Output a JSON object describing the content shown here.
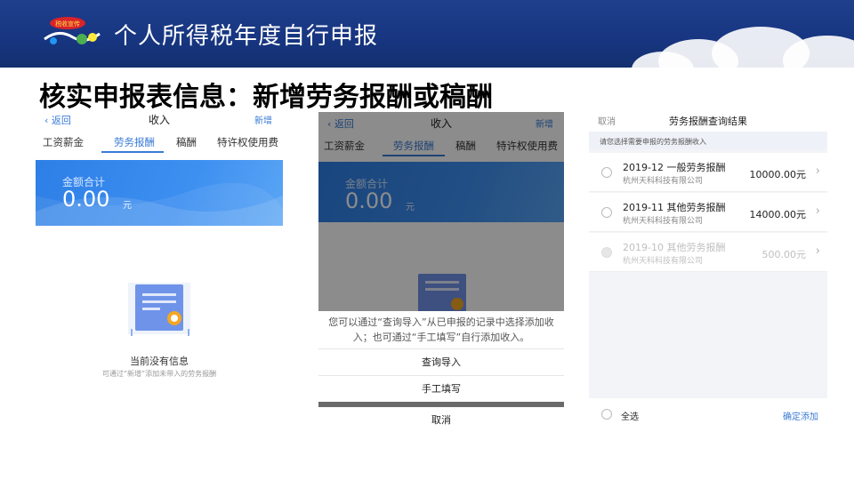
{
  "header": {
    "title": "个人所得税年度自行申报",
    "logo_text": "税收宣传"
  },
  "heading": "核实申报表信息：新增劳务报酬或稿酬",
  "screen1": {
    "back": "返回",
    "title": "收入",
    "add": "新增",
    "tabs": [
      "工资薪金",
      "劳务报酬",
      "稿酬",
      "特许权使用费"
    ],
    "active_tab": 1,
    "total_label": "金额合计",
    "total_amount": "0.00",
    "unit": "元",
    "empty_title": "当前没有信息",
    "empty_hint": "可通过“新增”添加未带入的劳务报酬"
  },
  "screen2": {
    "back": "返回",
    "title": "收入",
    "add": "新增",
    "tabs": [
      "工资薪金",
      "劳务报酬",
      "稿酬",
      "特许权使用费"
    ],
    "total_label": "金额合计",
    "total_amount": "0.00",
    "unit": "元",
    "sheet_message": "您可以通过“查询导入”从已申报的记录中选择添加收入；也可通过“手工填写”自行添加收入。",
    "option_query": "查询导入",
    "option_manual": "手工填写",
    "option_cancel": "取消"
  },
  "screen3": {
    "cancel": "取消",
    "title": "劳务报酬查询结果",
    "hint": "请您选择需要申报的劳务报酬收入",
    "rows": [
      {
        "name": "2019-12 一般劳务报酬",
        "company": "杭州天科科技有限公司",
        "amount": "10000.00元",
        "disabled": false
      },
      {
        "name": "2019-11 其他劳务报酬",
        "company": "杭州天科科技有限公司",
        "amount": "14000.00元",
        "disabled": false
      },
      {
        "name": "2019-10 其他劳务报酬",
        "company": "杭州天科科技有限公司",
        "amount": "500.00元",
        "disabled": true
      }
    ],
    "select_all": "全选",
    "confirm": "确定添加"
  },
  "colors": {
    "accent": "#3a7bd5",
    "banner": "#1f3f8c",
    "card": "#2e7fe6"
  }
}
